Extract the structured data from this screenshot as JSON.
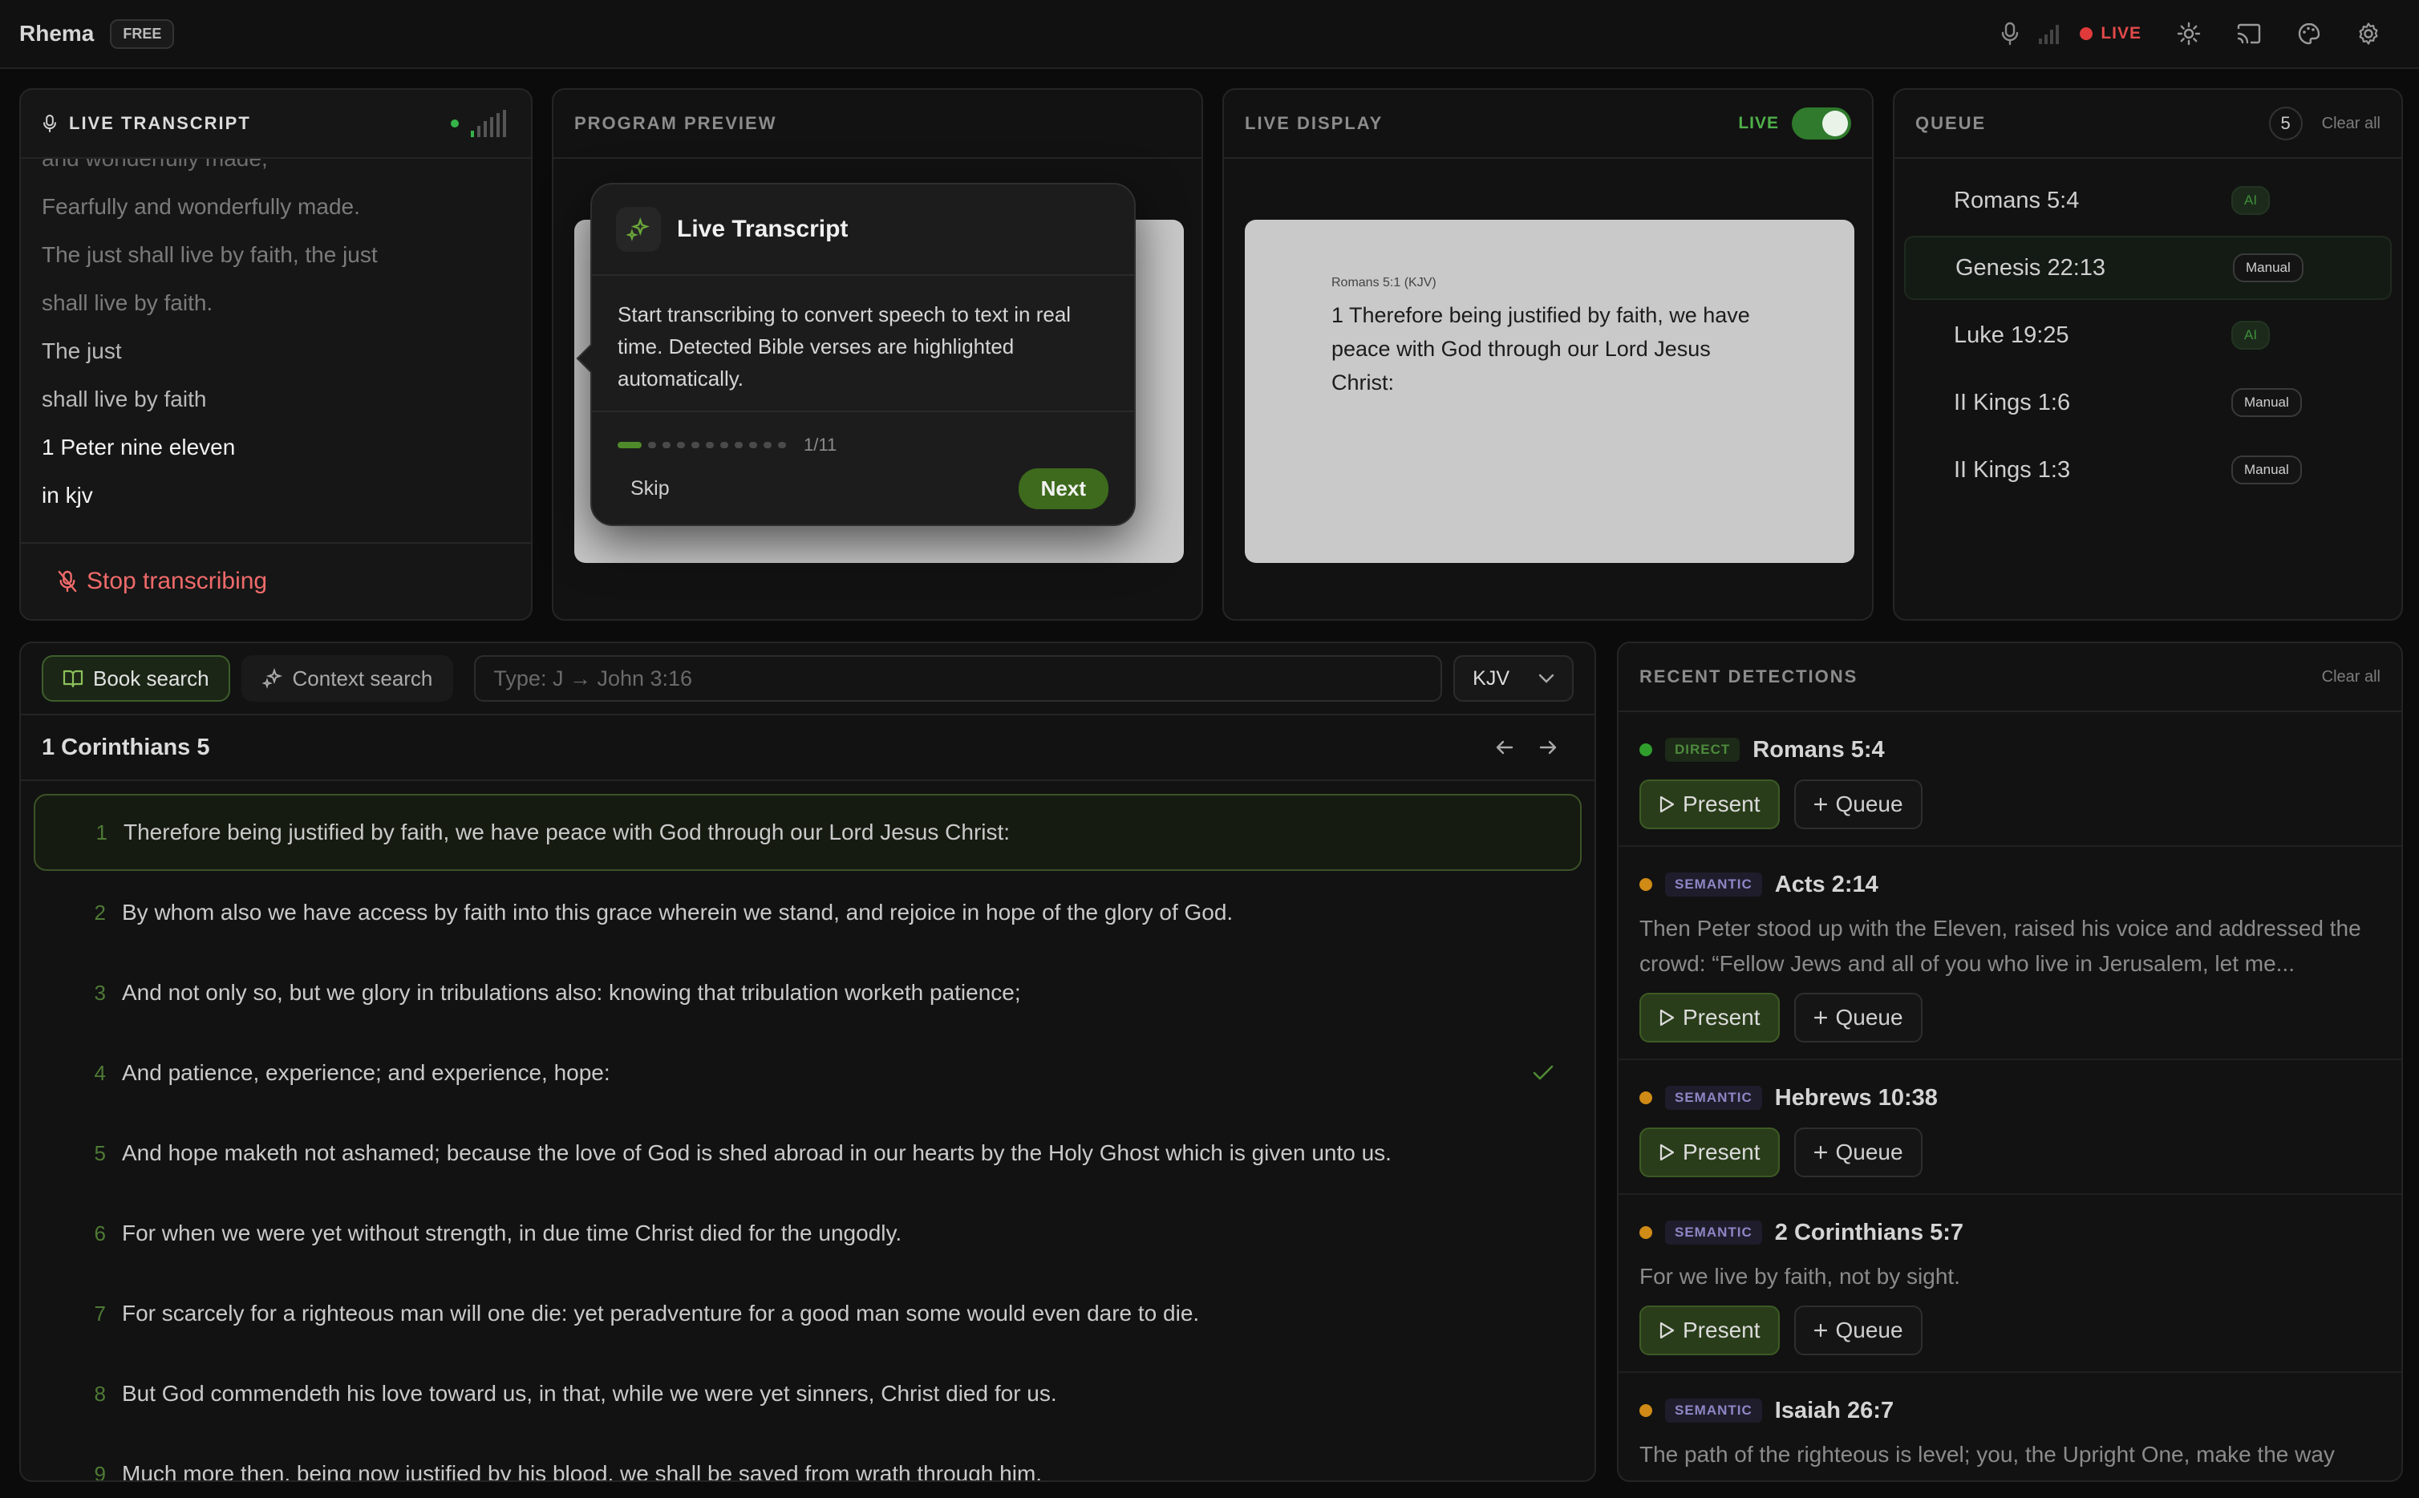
{
  "app": {
    "name": "Rhema",
    "tier": "FREE"
  },
  "topbar": {
    "live_label": "LIVE",
    "icons": [
      "mic-icon",
      "signal-bars-icon",
      "sun-icon",
      "cast-icon",
      "palette-icon",
      "gear-icon"
    ],
    "live_color": "#e03a3a"
  },
  "transcript": {
    "title": "LIVE TRANSCRIPT",
    "lines": [
      "and wonderfully made,",
      "Fearfully and wonderfully made.",
      "The just shall live by faith, the just",
      "shall live by faith.",
      "The just",
      "shall live by faith",
      "1 Peter nine eleven",
      "in kjv"
    ],
    "stop_label": "Stop transcribing"
  },
  "preview": {
    "title": "PROGRAM PREVIEW"
  },
  "display": {
    "title": "LIVE DISPLAY",
    "live_label": "LIVE",
    "ref": "Romans 5:1 (KJV)",
    "text": "1 Therefore being justified by faith, we have peace with God through our Lord Jesus Christ:"
  },
  "queue": {
    "title": "QUEUE",
    "count": "5",
    "clear_label": "Clear all",
    "items": [
      {
        "ref": "Romans 5:4",
        "badge": "AI"
      },
      {
        "ref": "Genesis 22:13",
        "badge": "Manual"
      },
      {
        "ref": "Luke 19:25",
        "badge": "AI"
      },
      {
        "ref": "II Kings 1:6",
        "badge": "Manual"
      },
      {
        "ref": "II Kings 1:3",
        "badge": "Manual"
      }
    ]
  },
  "search": {
    "book_search_label": "Book search",
    "context_search_label": "Context search",
    "placeholder": "Type: J → John 3:16",
    "version": "KJV",
    "chapter_title": "1 Corinthians 5",
    "verses": [
      {
        "num": "1",
        "text": "Therefore being justified by faith, we have peace with God through our Lord Jesus Christ:"
      },
      {
        "num": "2",
        "text": "By whom also we have access by faith into this grace wherein we stand, and rejoice in hope of the glory of God."
      },
      {
        "num": "3",
        "text": "And not only so, but we glory in tribulations also: knowing that tribulation worketh patience;"
      },
      {
        "num": "4",
        "text": "And patience, experience; and experience, hope:"
      },
      {
        "num": "5",
        "text": "And hope maketh not ashamed; because the love of God is shed abroad in our hearts by the Holy Ghost which is given unto us."
      },
      {
        "num": "6",
        "text": "For when we were yet without strength, in due time Christ died for the ungodly."
      },
      {
        "num": "7",
        "text": "For scarcely for a righteous man will one die: yet peradventure for a good man some would even dare to die."
      },
      {
        "num": "8",
        "text": "But God commendeth his love toward us, in that, while we were yet sinners, Christ died for us."
      },
      {
        "num": "9",
        "text": "Much more then, being now justified by his blood, we shall be saved from wrath through him."
      }
    ]
  },
  "recent": {
    "title": "RECENT DETECTIONS",
    "clear_label": "Clear all",
    "present_label": "Present",
    "queue_label": "Queue",
    "items": [
      {
        "type": "DIRECT",
        "ref": "Romans 5:4",
        "text": ""
      },
      {
        "type": "SEMANTIC",
        "ref": "Acts 2:14",
        "text": "Then Peter stood up with the Eleven, raised his voice and addressed the crowd: “Fellow Jews and all of you who live in Jerusalem, let me..."
      },
      {
        "type": "SEMANTIC",
        "ref": "Hebrews 10:38",
        "text": ""
      },
      {
        "type": "SEMANTIC",
        "ref": "2 Corinthians 5:7",
        "text": "For we live by faith, not by sight."
      },
      {
        "type": "SEMANTIC",
        "ref": "Isaiah 26:7",
        "text": "The path of the righteous is level; you, the Upright One, make the way"
      }
    ]
  },
  "tour": {
    "title": "Live Transcript",
    "body": "Start transcribing to convert speech to text in real time. Detected Bible verses are highlighted automatically.",
    "step": "1/11",
    "skip_label": "Skip",
    "next_label": "Next"
  }
}
